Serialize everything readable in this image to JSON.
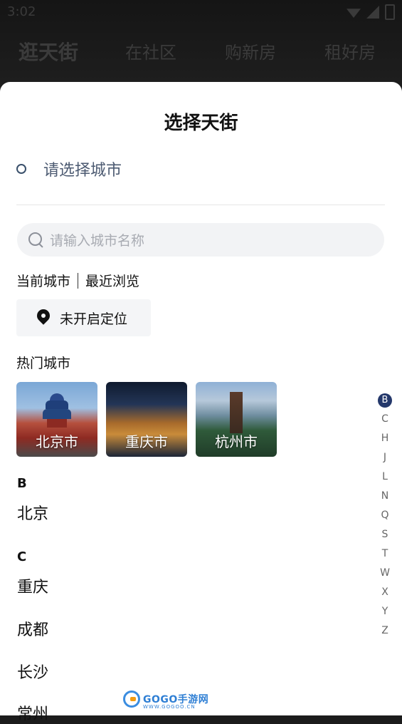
{
  "status": {
    "time": "3:02"
  },
  "topnav": [
    "逛天街",
    "在社区",
    "购新房",
    "租好房"
  ],
  "sheet": {
    "title": "选择天街",
    "selected_placeholder": "请选择城市",
    "search_placeholder": "请输入城市名称",
    "tab_current": "当前城市",
    "tab_recent": "最近浏览",
    "location_label": "未开启定位",
    "hot_title": "热门城市",
    "hot_cities": [
      "北京市",
      "重庆市",
      "杭州市"
    ],
    "sections": [
      {
        "letter": "B",
        "cities": [
          "北京"
        ]
      },
      {
        "letter": "C",
        "cities": [
          "重庆",
          "成都",
          "长沙",
          "常州"
        ]
      }
    ]
  },
  "alpha_index": [
    "B",
    "C",
    "H",
    "J",
    "L",
    "N",
    "Q",
    "S",
    "T",
    "W",
    "X",
    "Y",
    "Z"
  ],
  "alpha_active": "B",
  "watermark": {
    "brand": "GOGO手游网",
    "url": "WWW.GOGOO.CN"
  },
  "colors": {
    "accent": "#24386b",
    "sheet_bg": "#ffffff",
    "search_bg": "#f2f3f5"
  }
}
